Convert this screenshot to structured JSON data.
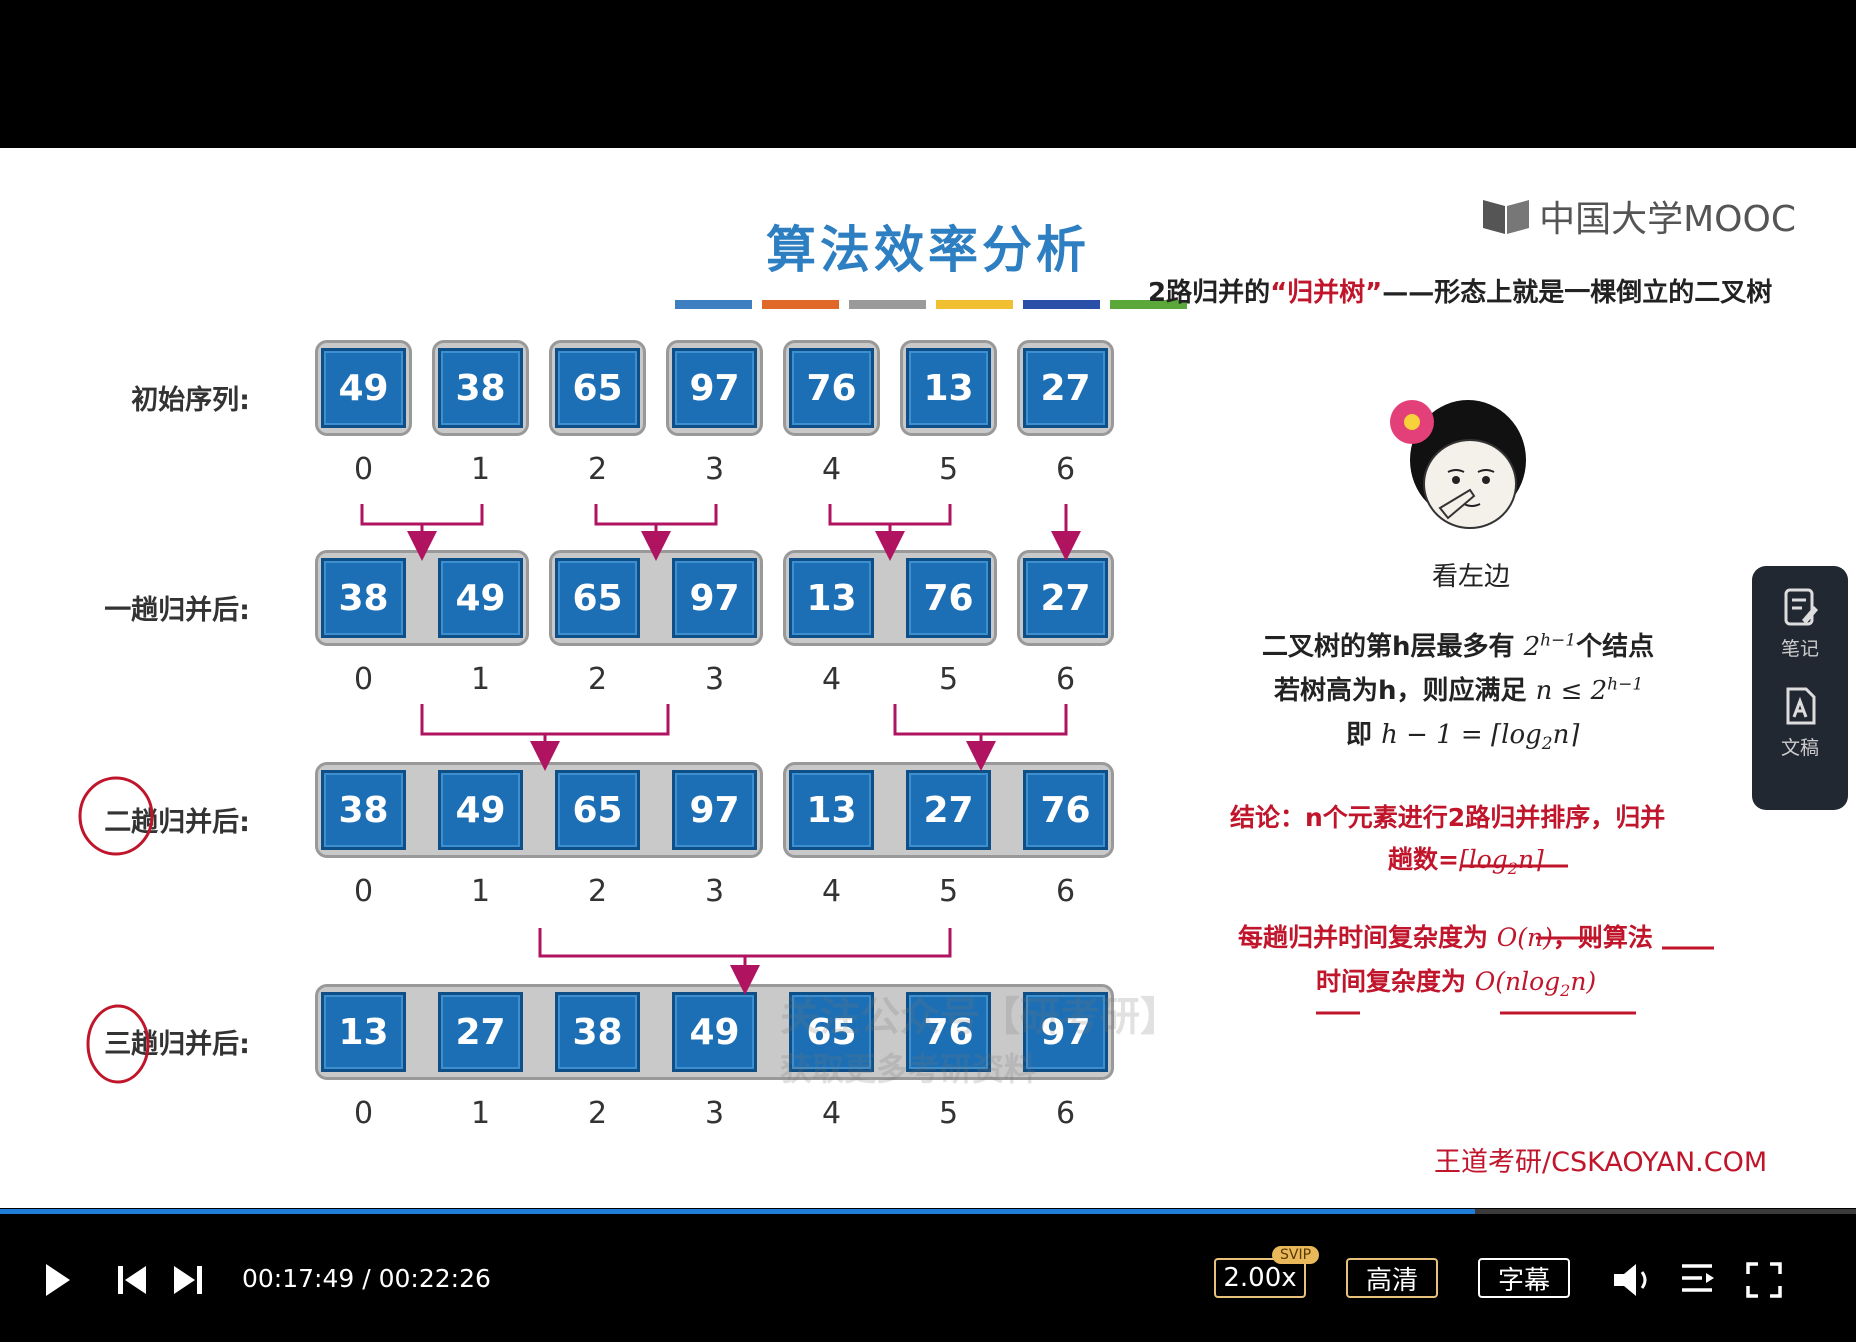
{
  "slide": {
    "title": "算法效率分析",
    "color_bars": [
      "#3e7fc1",
      "#e0692a",
      "#9a9a9a",
      "#f0c030",
      "#2a4fa8",
      "#5aa83a"
    ],
    "logo": "中国大学MOOC",
    "rows": [
      {
        "label": "初始序列:",
        "values": [
          "49",
          "38",
          "65",
          "97",
          "76",
          "13",
          "27"
        ],
        "indices": [
          "0",
          "1",
          "2",
          "3",
          "4",
          "5",
          "6"
        ]
      },
      {
        "label": "一趟归并后:",
        "values": [
          "38",
          "49",
          "65",
          "97",
          "13",
          "76",
          "27"
        ],
        "indices": [
          "0",
          "1",
          "2",
          "3",
          "4",
          "5",
          "6"
        ]
      },
      {
        "label": "二趟归并后:",
        "values": [
          "38",
          "49",
          "65",
          "97",
          "13",
          "27",
          "76"
        ],
        "indices": [
          "0",
          "1",
          "2",
          "3",
          "4",
          "5",
          "6"
        ]
      },
      {
        "label": "三趟归并后:",
        "values": [
          "13",
          "27",
          "38",
          "49",
          "65",
          "76",
          "97"
        ],
        "indices": [
          "0",
          "1",
          "2",
          "3",
          "4",
          "5",
          "6"
        ]
      }
    ],
    "right": {
      "heading_prefix": "2路归并的",
      "heading_quote": "“归并树”",
      "heading_suffix": "——形态上就是一棵倒立的二叉树",
      "meme_caption": "看左边",
      "line1_prefix": "二叉树的第h层最多有 ",
      "line1_math": "2",
      "line1_sup": "h−1",
      "line1_suffix": "个结点",
      "line2_prefix": "若树高为h，则应满足 ",
      "line2_math": "n ≤ 2",
      "line2_sup": "h−1",
      "line3_prefix": "即 ",
      "line3_math": "h − 1 = ⌈log",
      "line3_sub": "2",
      "line3_tail": "n⌉",
      "conclusion1": "结论：n个元素进行2路归并排序，归并",
      "conclusion2_prefix": "趟数=",
      "conclusion2_math": "⌈log",
      "conclusion2_sub": "2",
      "conclusion2_tail": "n⌉",
      "complexity1_prefix": "每趟归并时间复杂度为 ",
      "complexity1_math": "O(n)",
      "complexity1_suffix": "，则算法",
      "complexity2_prefix": "时间复杂度为 ",
      "complexity2_math": "O(nlog",
      "complexity2_sub": "2",
      "complexity2_tail": "n)"
    },
    "watermark1": "关注公众号【研考研】",
    "watermark2": "获取更多考研资料",
    "footer": "王道考研/CSKAOYAN.COM"
  },
  "sidepanel": {
    "notes_label": "笔记",
    "doc_label": "文稿"
  },
  "controls": {
    "current_time": "00:17:49",
    "separator": "/",
    "total_time": "00:22:26",
    "progress": 0.7945,
    "speed": "2.00x",
    "svip_badge": "SVIP",
    "quality": "高清",
    "subtitle": "字幕"
  }
}
